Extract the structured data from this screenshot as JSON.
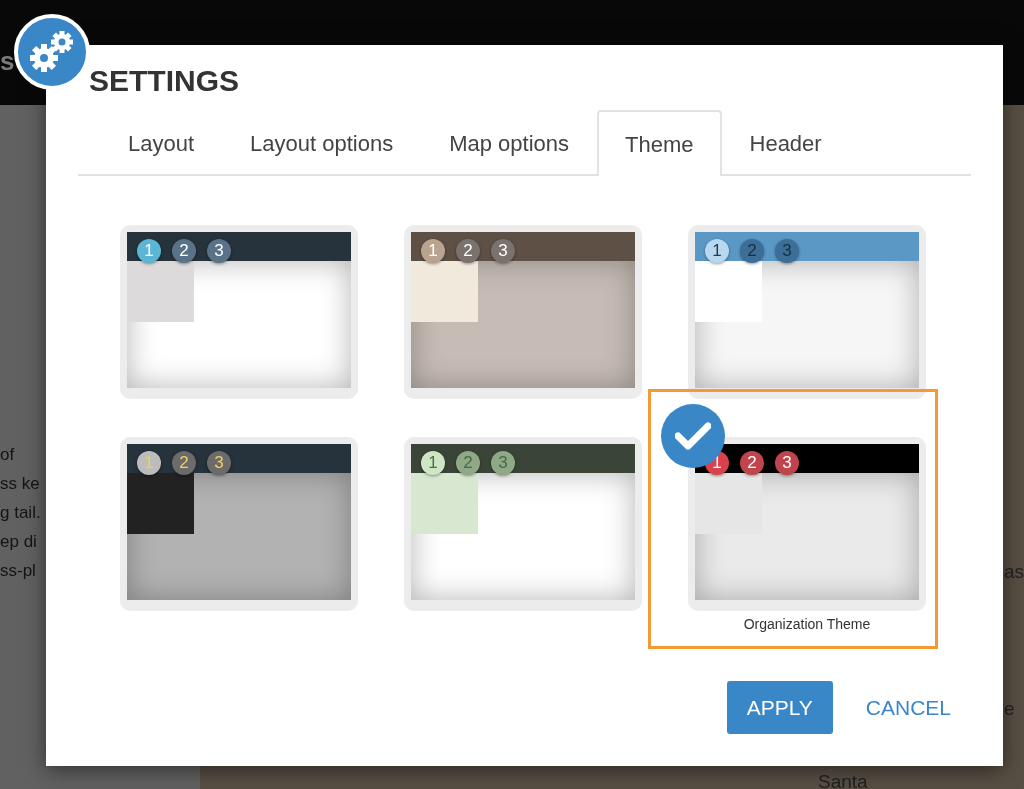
{
  "background": {
    "header_fragment": "s",
    "text_lines": [
      "of",
      "ss ke",
      "g tail.",
      "ep di",
      "ss-pl"
    ],
    "map_labels": [
      "as",
      "e",
      "Santa"
    ]
  },
  "dialog": {
    "title": "SETTINGS",
    "tabs": [
      {
        "label": "Layout",
        "selected": false
      },
      {
        "label": "Layout options",
        "selected": false
      },
      {
        "label": "Map options",
        "selected": false
      },
      {
        "label": "Theme",
        "selected": true
      },
      {
        "label": "Header",
        "selected": false
      }
    ],
    "themes": [
      {
        "selected": false,
        "header": {
          "color": "#26323c"
        },
        "sidebar": {
          "color": "#dcdadb"
        },
        "body": {
          "color": "#ffffff"
        },
        "steps": [
          {
            "color": "#5bb6d6",
            "number": {
              "label": "1",
              "color": "#ffffff"
            }
          },
          {
            "color": "#5a7287",
            "number": {
              "label": "2",
              "color": "#ffffff"
            }
          },
          {
            "color": "#5a7287",
            "number": {
              "label": "3",
              "color": "#ffffff"
            }
          }
        ]
      },
      {
        "selected": false,
        "header": {
          "color": "#5f5046"
        },
        "sidebar": {
          "color": "#f2e9dd"
        },
        "body": {
          "color": "#c6bcb5"
        },
        "steps": [
          {
            "color": "#b8a48f",
            "number": {
              "label": "1",
              "color": "#ffffff"
            }
          },
          {
            "color": "#7a726d",
            "number": {
              "label": "2",
              "color": "#ffffff"
            }
          },
          {
            "color": "#7a726d",
            "number": {
              "label": "3",
              "color": "#ffffff"
            }
          }
        ]
      },
      {
        "selected": false,
        "header": {
          "color": "#5c98c6"
        },
        "sidebar": {
          "color": "#ffffff"
        },
        "body": {
          "color": "#f6f6f6"
        },
        "steps": [
          {
            "color": "#b7d8ee",
            "number": {
              "label": "1",
              "color": "#1f3b52"
            }
          },
          {
            "color": "#3c6f98",
            "number": {
              "label": "2",
              "color": "#1a2d3d"
            }
          },
          {
            "color": "#3c6f98",
            "number": {
              "label": "3",
              "color": "#1a2d3d"
            }
          }
        ]
      },
      {
        "selected": false,
        "header": {
          "color": "#26323c"
        },
        "sidebar": {
          "color": "#222222"
        },
        "body": {
          "color": "#b2b2b2"
        },
        "steps": [
          {
            "color": "#bcbcbc",
            "number": {
              "label": "1",
              "color": "#f0d060"
            }
          },
          {
            "color": "#6b6b6b",
            "number": {
              "label": "2",
              "color": "#f0d060"
            }
          },
          {
            "color": "#6b6b6b",
            "number": {
              "label": "3",
              "color": "#f0d060"
            }
          }
        ]
      },
      {
        "selected": false,
        "header": {
          "color": "#3a4538"
        },
        "sidebar": {
          "color": "#d8e8d0"
        },
        "body": {
          "color": "#ffffff"
        },
        "steps": [
          {
            "color": "#cfe6c6",
            "number": {
              "label": "1",
              "color": "#4e6e4a"
            }
          },
          {
            "color": "#8fa886",
            "number": {
              "label": "2",
              "color": "#4a6845"
            }
          },
          {
            "color": "#8fa886",
            "number": {
              "label": "3",
              "color": "#4a6845"
            }
          }
        ]
      },
      {
        "selected": true,
        "name": "Organization Theme",
        "header": {
          "color": "#000000"
        },
        "sidebar": {
          "color": "#e6e6e6"
        },
        "body": {
          "color": "#eaeaea"
        },
        "steps": [
          {
            "color": "#d9424d",
            "number": {
              "label": "1",
              "color": "#ffffff"
            }
          },
          {
            "color": "#c0444c",
            "number": {
              "label": "2",
              "color": "#ffffff"
            }
          },
          {
            "color": "#c0444c",
            "number": {
              "label": "3",
              "color": "#ffffff"
            }
          }
        ]
      }
    ],
    "buttons": [
      {
        "label": "APPLY",
        "kind": "primary"
      },
      {
        "label": "CANCEL",
        "kind": "link"
      }
    ]
  }
}
